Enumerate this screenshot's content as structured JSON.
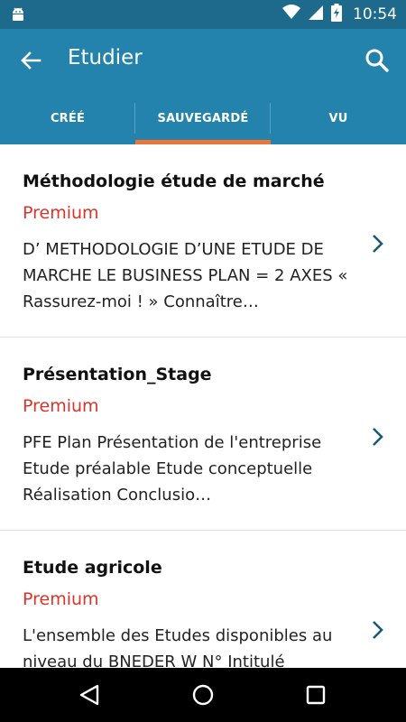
{
  "status_bar": {
    "time": "10:54",
    "icons": [
      "android-icon",
      "wifi-icon",
      "signal-icon",
      "battery-charging-icon"
    ]
  },
  "app_bar": {
    "title": "Etudier",
    "back_icon": "arrow-left-icon",
    "search_icon": "search-icon"
  },
  "tabs": [
    {
      "label": "CRÉÉ",
      "active": false
    },
    {
      "label": "SAUVEGARDÉ",
      "active": true
    },
    {
      "label": "VU",
      "active": false
    }
  ],
  "colors": {
    "status_bar": "#1d6a8c",
    "primary": "#2483ad",
    "tab_indicator": "#e8763a",
    "premium": "#d9352b"
  },
  "items": [
    {
      "title": "Méthodologie étude de marché",
      "badge": "Premium",
      "excerpt": "D’ METHODOLOGIE D’UNE ETUDE DE MARCHE LE BUSINESS PLAN = 2 AXES « Rassurez-moi ! » Connaître…"
    },
    {
      "title": "Présentation_Stage",
      "badge": "Premium",
      "excerpt": "PFE Plan Présentation de l'entreprise Etude préalable Etude conceptuelle Réalisation Conclusio…"
    },
    {
      "title": "Etude agricole",
      "badge": "Premium",
      "excerpt": "L'ensemble des Etudes disponibles au niveau du BNEDER W N° Intitulé"
    }
  ],
  "nav_bar": [
    "back-triangle-icon",
    "home-circle-icon",
    "recents-square-icon"
  ]
}
